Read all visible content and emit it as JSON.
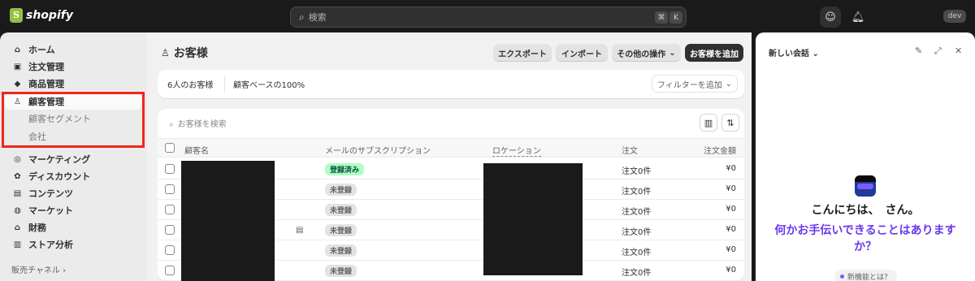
{
  "topbar": {
    "brand": "shopify",
    "search_placeholder": "検索",
    "shortcut": [
      "⌘",
      "K"
    ],
    "badge": "dev"
  },
  "sidebar": {
    "items": [
      {
        "label": "ホーム",
        "icon": "home-icon"
      },
      {
        "label": "注文管理",
        "icon": "inbox-icon"
      },
      {
        "label": "商品管理",
        "icon": "tag-icon"
      },
      {
        "label": "顧客管理",
        "icon": "person-icon"
      },
      {
        "label": "顧客セグメント"
      },
      {
        "label": "会社"
      },
      {
        "label": "マーケティング",
        "icon": "target-icon"
      },
      {
        "label": "ディスカウント",
        "icon": "discount-icon"
      },
      {
        "label": "コンテンツ",
        "icon": "content-icon"
      },
      {
        "label": "マーケット",
        "icon": "globe-icon"
      },
      {
        "label": "財務",
        "icon": "bank-icon"
      },
      {
        "label": "ストア分析",
        "icon": "chart-icon"
      }
    ],
    "sales_channels": "販売チャネル"
  },
  "page": {
    "title": "お客様",
    "actions": [
      "エクスポート",
      "インポート",
      "その他の操作",
      "お客様を追加"
    ],
    "stats": [
      "6人のお客様",
      "顧客ベースの100%"
    ],
    "filter_button": "フィルターを追加"
  },
  "table": {
    "search_placeholder": "お客様を検索",
    "columns": [
      "顧客名",
      "メールのサブスクリプション",
      "ロケーション",
      "注文",
      "注文金額"
    ],
    "rows": [
      {
        "subscription": "登録済み",
        "subscribed": true,
        "orders": "注文0件",
        "amount": "¥0"
      },
      {
        "subscription": "未登録",
        "subscribed": false,
        "orders": "注文0件",
        "amount": "¥0"
      },
      {
        "subscription": "未登録",
        "subscribed": false,
        "orders": "注文0件",
        "amount": "¥0"
      },
      {
        "subscription": "未登録",
        "subscribed": false,
        "orders": "注文0件",
        "amount": "¥0"
      },
      {
        "subscription": "未登録",
        "subscribed": false,
        "orders": "注文0件",
        "amount": "¥0"
      },
      {
        "subscription": "未登録",
        "subscribed": false,
        "orders": "注文0件",
        "amount": "¥0"
      }
    ]
  },
  "sidekick": {
    "title": "新しい会話",
    "greeting": "こんにちは、　さん。",
    "help_text": "何かお手伝いできることはありますか？",
    "new_features": "新機能とは？"
  }
}
